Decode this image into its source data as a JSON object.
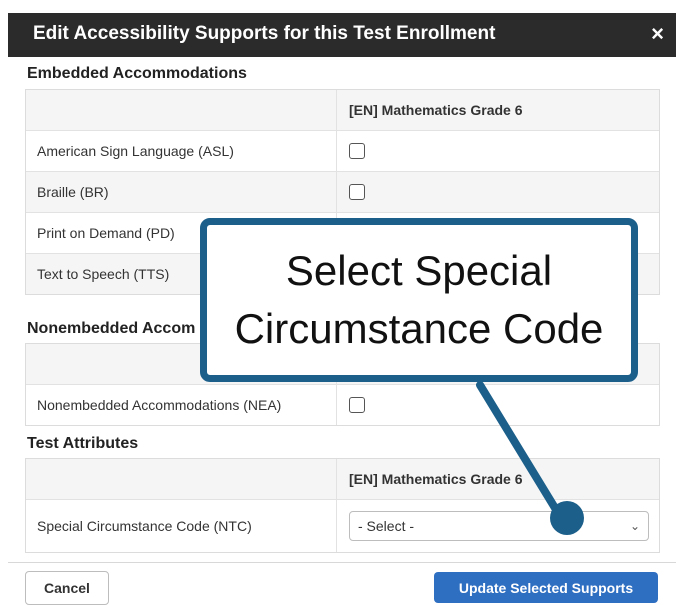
{
  "dialog": {
    "title": "Edit Accessibility Supports for this Test Enrollment",
    "close_glyph": "×"
  },
  "embedded": {
    "section_title": "Embedded Accommodations",
    "column_header": "[EN] Mathematics Grade 6",
    "rows": [
      {
        "label": "American Sign Language (ASL)"
      },
      {
        "label": "Braille (BR)"
      },
      {
        "label": "Print on Demand (PD)"
      },
      {
        "label": "Text to Speech (TTS)"
      }
    ]
  },
  "nonembedded": {
    "section_title": "Nonembedded Accom",
    "rows": [
      {
        "label": "Nonembedded Accommodations (NEA)"
      }
    ]
  },
  "test_attributes": {
    "section_title": "Test Attributes",
    "column_header": "[EN] Mathematics Grade 6",
    "rows": [
      {
        "label": "Special Circumstance Code (NTC)",
        "select_value": "- Select -"
      }
    ]
  },
  "footer": {
    "cancel_label": "Cancel",
    "update_label": "Update Selected Supports"
  },
  "callout": {
    "line1": "Select Special",
    "line2": "Circumstance Code",
    "border_color": "#1b5f8a"
  },
  "colors": {
    "titlebar": "#2b2b2b",
    "primary_button": "#2f6fc2"
  },
  "icons": {
    "close": "close-icon",
    "dropdown": "chevron-down-icon"
  }
}
